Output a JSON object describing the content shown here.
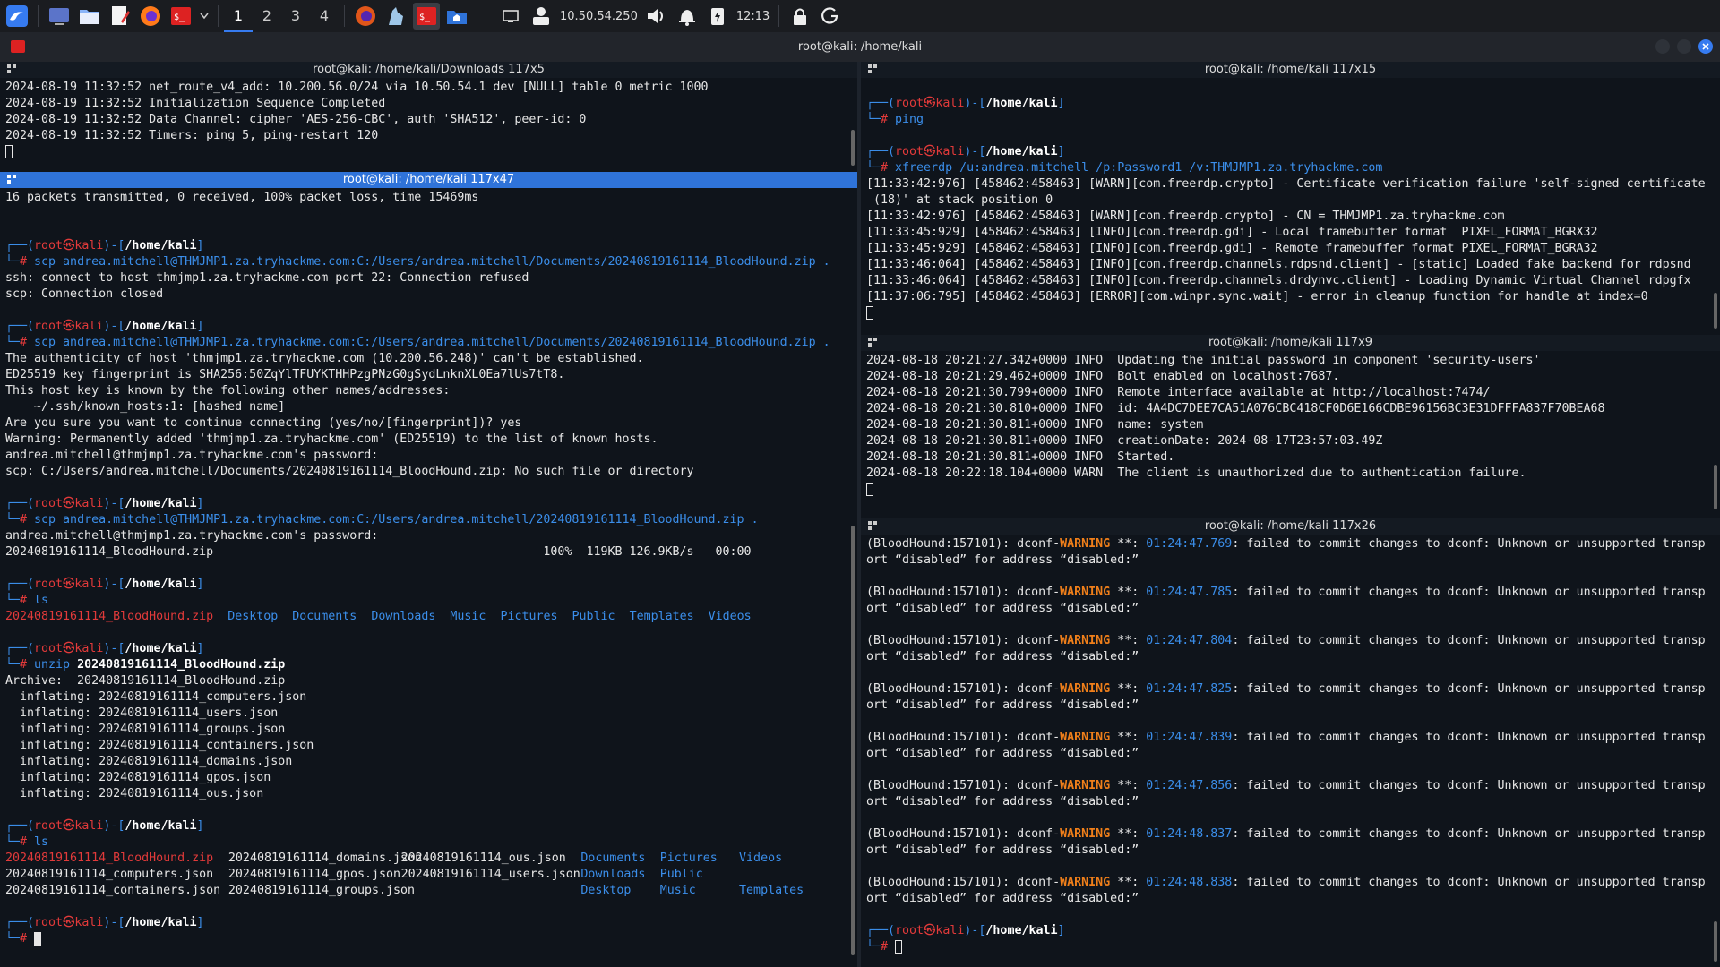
{
  "taskbar": {
    "workspaces": [
      "1",
      "2",
      "3",
      "4"
    ],
    "active_workspace": "1",
    "ip": "10.50.54.250",
    "clock": "12:13"
  },
  "window": {
    "title": "root@kali: /home/kali"
  },
  "panes": {
    "top_left": {
      "title": "root@kali: /home/kali/Downloads 117x5",
      "lines": [
        "2024-08-19 11:32:52 net_route_v4_add: 10.200.56.0/24 via 10.50.54.1 dev [NULL] table 0 metric 1000",
        "2024-08-19 11:32:52 Initialization Sequence Completed",
        "2024-08-19 11:32:52 Data Channel: cipher 'AES-256-CBC', auth 'SHA512', peer-id: 0",
        "2024-08-19 11:32:52 Timers: ping 5, ping-restart 120"
      ]
    },
    "main_left": {
      "title": "root@kali: /home/kali 117x47",
      "prompt_user": "root",
      "prompt_at": "㉿",
      "prompt_host": "kali",
      "prompt_dir": "/home/kali",
      "lines": {
        "l1": "16 packets transmitted, 0 received, 100% packet loss, time 15469ms",
        "c1": "scp andrea.mitchell@THMJMP1.za.tryhackme.com:C:/Users/andrea.mitchell/Documents/20240819161114_BloodHound.zip .",
        "o1a": "ssh: connect to host thmjmp1.za.tryhackme.com port 22: Connection refused",
        "o1b": "scp: Connection closed",
        "c2": "scp andrea.mitchell@THMJMP1.za.tryhackme.com:C:/Users/andrea.mitchell/Documents/20240819161114_BloodHound.zip .",
        "o2a": "The authenticity of host 'thmjmp1.za.tryhackme.com (10.200.56.248)' can't be established.",
        "o2b": "ED25519 key fingerprint is SHA256:50ZqYlTFUYKTHHPzgPNzG0gSydLnknXL0Ea7lUs7tT8.",
        "o2c": "This host key is known by the following other names/addresses:",
        "o2d": "    ~/.ssh/known_hosts:1: [hashed name]",
        "o2e": "Are you sure you want to continue connecting (yes/no/[fingerprint])? yes",
        "o2f": "Warning: Permanently added 'thmjmp1.za.tryhackme.com' (ED25519) to the list of known hosts.",
        "o2g": "andrea.mitchell@thmjmp1.za.tryhackme.com's password:",
        "o2h": "scp: C:/Users/andrea.mitchell/Documents/20240819161114_BloodHound.zip: No such file or directory",
        "c3": "scp andrea.mitchell@THMJMP1.za.tryhackme.com:C:/Users/andrea.mitchell/20240819161114_BloodHound.zip .",
        "o3a": "andrea.mitchell@thmjmp1.za.tryhackme.com's password:",
        "o3b": "20240819161114_BloodHound.zip                                              100%  119KB 126.9KB/s   00:00",
        "c4": "ls",
        "c5": "unzip",
        "c5arg": "20240819161114_BloodHound.zip",
        "o5a": "Archive:  20240819161114_BloodHound.zip",
        "o5b": "  inflating: 20240819161114_computers.json",
        "o5c": "  inflating: 20240819161114_users.json",
        "o5d": "  inflating: 20240819161114_groups.json",
        "o5e": "  inflating: 20240819161114_containers.json",
        "o5f": "  inflating: 20240819161114_domains.json",
        "o5g": "  inflating: 20240819161114_gpos.json",
        "o5h": "  inflating: 20240819161114_ous.json",
        "c6": "ls"
      },
      "ls1": {
        "zip": "20240819161114_BloodHound.zip",
        "dirs": [
          "Desktop",
          "Documents",
          "Downloads",
          "Music",
          "Pictures",
          "Public",
          "Templates",
          "Videos"
        ]
      },
      "ls2": {
        "r1": [
          "20240819161114_BloodHound.zip",
          "20240819161114_domains.json",
          "20240819161114_ous.json",
          "Documents",
          "Pictures",
          "Videos"
        ],
        "r2": [
          "20240819161114_computers.json",
          "20240819161114_gpos.json",
          "20240819161114_users.json",
          "Downloads",
          "Public"
        ],
        "r3": [
          "20240819161114_containers.json",
          "20240819161114_groups.json",
          "Desktop",
          "Music",
          "Templates"
        ]
      }
    },
    "top_right": {
      "title": "root@kali: /home/kali 117x15",
      "c1": "ping",
      "c2": "xfreerdp /u:andrea.mitchell /p:Password1 /v:THMJMP1.za.tryhackme.com",
      "lines": [
        "[11:33:42:976] [458462:458463] [WARN][com.freerdp.crypto] - Certificate verification failure 'self-signed certificate",
        " (18)' at stack position 0",
        "[11:33:42:976] [458462:458463] [WARN][com.freerdp.crypto] - CN = THMJMP1.za.tryhackme.com",
        "[11:33:45:929] [458462:458463] [INFO][com.freerdp.gdi] - Local framebuffer format  PIXEL_FORMAT_BGRX32",
        "[11:33:45:929] [458462:458463] [INFO][com.freerdp.gdi] - Remote framebuffer format PIXEL_FORMAT_BGRA32",
        "[11:33:46:064] [458462:458463] [INFO][com.freerdp.channels.rdpsnd.client] - [static] Loaded fake backend for rdpsnd",
        "[11:33:46:064] [458462:458463] [INFO][com.freerdp.channels.drdynvc.client] - Loading Dynamic Virtual Channel rdpgfx",
        "[11:37:06:795] [458462:458463] [ERROR][com.winpr.sync.wait] - error in cleanup function for handle at index=0"
      ]
    },
    "mid_right": {
      "title": "root@kali: /home/kali 117x9",
      "lines": [
        "2024-08-18 20:21:27.342+0000 INFO  Updating the initial password in component 'security-users'",
        "2024-08-18 20:21:29.462+0000 INFO  Bolt enabled on localhost:7687.",
        "2024-08-18 20:21:30.799+0000 INFO  Remote interface available at http://localhost:7474/",
        "2024-08-18 20:21:30.810+0000 INFO  id: 4A4DC7DEE7CA51A076CBC418CF0D6E166CDBE96156BC3E31DFFFA837F70BEA68",
        "2024-08-18 20:21:30.811+0000 INFO  name: system",
        "2024-08-18 20:21:30.811+0000 INFO  creationDate: 2024-08-17T23:57:03.49Z",
        "2024-08-18 20:21:30.811+0000 INFO  Started.",
        "2024-08-18 20:22:18.104+0000 WARN  The client is unauthorized due to authentication failure."
      ]
    },
    "bottom_right": {
      "title": "root@kali: /home/kali 117x26",
      "prefix": "(BloodHound:157101): dconf-",
      "warning": "WARNING",
      "stars": " **: ",
      "msg": ": failed to commit changes to dconf: Unknown or unsupported transp",
      "cont": "ort “disabled” for address “disabled:”",
      "timestamps": [
        "01:24:47.769",
        "01:24:47.785",
        "01:24:47.804",
        "01:24:47.825",
        "01:24:47.839",
        "01:24:47.856",
        "01:24:48.837",
        "01:24:48.838"
      ]
    }
  }
}
